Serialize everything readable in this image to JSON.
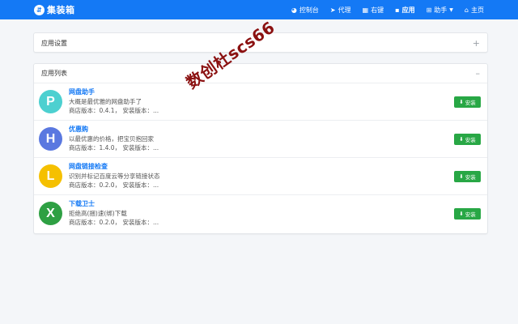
{
  "brand": {
    "logo_glyph": "⇵",
    "name": "集装箱"
  },
  "nav": [
    {
      "icon": "dashboard-icon",
      "glyph": "◕",
      "label": "控制台"
    },
    {
      "icon": "paper-plane-icon",
      "glyph": "➤",
      "label": "代理"
    },
    {
      "icon": "cubes-icon",
      "glyph": "▦",
      "label": "右键"
    },
    {
      "icon": "apps-icon",
      "glyph": "▪",
      "label": "应用",
      "active": true
    },
    {
      "icon": "plus-square-icon",
      "glyph": "⊞",
      "label": "助手",
      "dropdown": true
    },
    {
      "icon": "home-icon",
      "glyph": "⌂",
      "label": "主页"
    }
  ],
  "settings_card": {
    "title": "应用设置",
    "tool_glyph": "+"
  },
  "apps_card": {
    "title": "应用列表",
    "tool_glyph": "–"
  },
  "install_label": "安装",
  "apps": [
    {
      "letter": "P",
      "color": "#4dd0d0",
      "name": "网盘助手",
      "desc": "大概是最优雅的网盘助手了",
      "version": "商店版本：0.4.1， 安装版本：..."
    },
    {
      "letter": "H",
      "color": "#5a78e0",
      "name": "优惠购",
      "desc": "以最优惠的价格，把宝贝抱回家",
      "version": "商店版本：1.4.0， 安装版本：..."
    },
    {
      "letter": "L",
      "color": "#f5c000",
      "name": "网盘链接检查",
      "desc": "识别并标记百度云等分享链接状态",
      "version": "商店版本：0.2.0， 安装版本：..."
    },
    {
      "letter": "X",
      "color": "#2ea043",
      "name": "下载卫士",
      "desc": "拒绝高(捆)速(绑)下载",
      "version": "商店版本：0.2.0， 安装版本：..."
    }
  ],
  "watermark": "数创杜scs66"
}
